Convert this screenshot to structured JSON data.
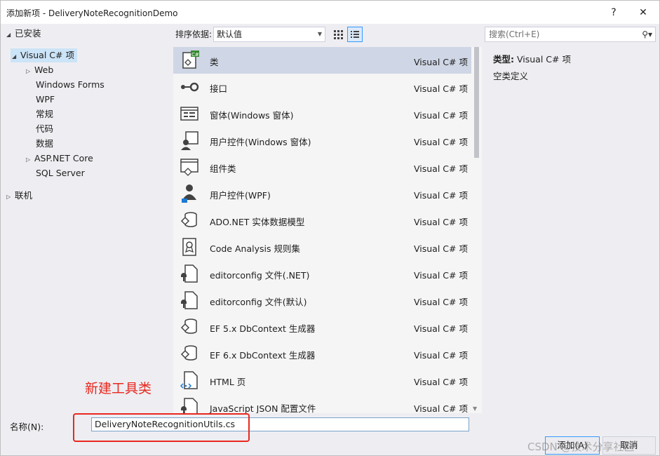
{
  "window": {
    "title": "添加新项 - DeliveryNoteRecognitionDemo",
    "help_label": "?",
    "close_label": "✕"
  },
  "tree": {
    "installed_label": "已安装",
    "visual_cs_label": "Visual C# 项",
    "children": [
      "Web",
      "Windows Forms",
      "WPF",
      "常规",
      "代码",
      "数据",
      "ASP.NET Core",
      "SQL Server"
    ],
    "online_label": "联机"
  },
  "toolbar": {
    "sort_label": "排序依据:",
    "sort_value": "默认值",
    "search_placeholder": "搜索(Ctrl+E)"
  },
  "items": [
    {
      "name": "类",
      "type": "Visual C# 项",
      "icon": "class-icon"
    },
    {
      "name": "接口",
      "type": "Visual C# 项",
      "icon": "interface-icon"
    },
    {
      "name": "窗体(Windows 窗体)",
      "type": "Visual C# 项",
      "icon": "windows-form-icon"
    },
    {
      "name": "用户控件(Windows 窗体)",
      "type": "Visual C# 项",
      "icon": "user-control-icon"
    },
    {
      "name": "组件类",
      "type": "Visual C# 项",
      "icon": "component-class-icon"
    },
    {
      "name": "用户控件(WPF)",
      "type": "Visual C# 项",
      "icon": "wpf-user-control-icon"
    },
    {
      "name": "ADO.NET 实体数据模型",
      "type": "Visual C# 项",
      "icon": "entity-model-icon"
    },
    {
      "name": "Code Analysis 规则集",
      "type": "Visual C# 项",
      "icon": "ruleset-icon"
    },
    {
      "name": "editorconfig 文件(.NET)",
      "type": "Visual C# 项",
      "icon": "editorconfig-icon"
    },
    {
      "name": "editorconfig 文件(默认)",
      "type": "Visual C# 项",
      "icon": "editorconfig-icon"
    },
    {
      "name": "EF 5.x DbContext 生成器",
      "type": "Visual C# 项",
      "icon": "dbcontext-icon"
    },
    {
      "name": "EF 6.x DbContext 生成器",
      "type": "Visual C# 项",
      "icon": "dbcontext-icon"
    },
    {
      "name": "HTML 页",
      "type": "Visual C# 项",
      "icon": "html-page-icon"
    },
    {
      "name": "JavaScript JSON 配置文件",
      "type": "Visual C# 项",
      "icon": "json-config-icon"
    }
  ],
  "detail": {
    "type_label": "类型:",
    "type_value": "Visual C# 项",
    "description": "空类定义"
  },
  "bottom": {
    "annotation": "新建工具类",
    "name_label": "名称(N):",
    "name_value": "DeliveryNoteRecognitionUtils.cs",
    "add_button": "添加(A)",
    "cancel_button": "取消"
  },
  "watermark": "CSDN @技术分享社区",
  "colors": {
    "selection": "#cfd6e5",
    "tree_selection": "#cce4f7",
    "annotation_red": "#e8281f",
    "accent": "#3399ff"
  }
}
